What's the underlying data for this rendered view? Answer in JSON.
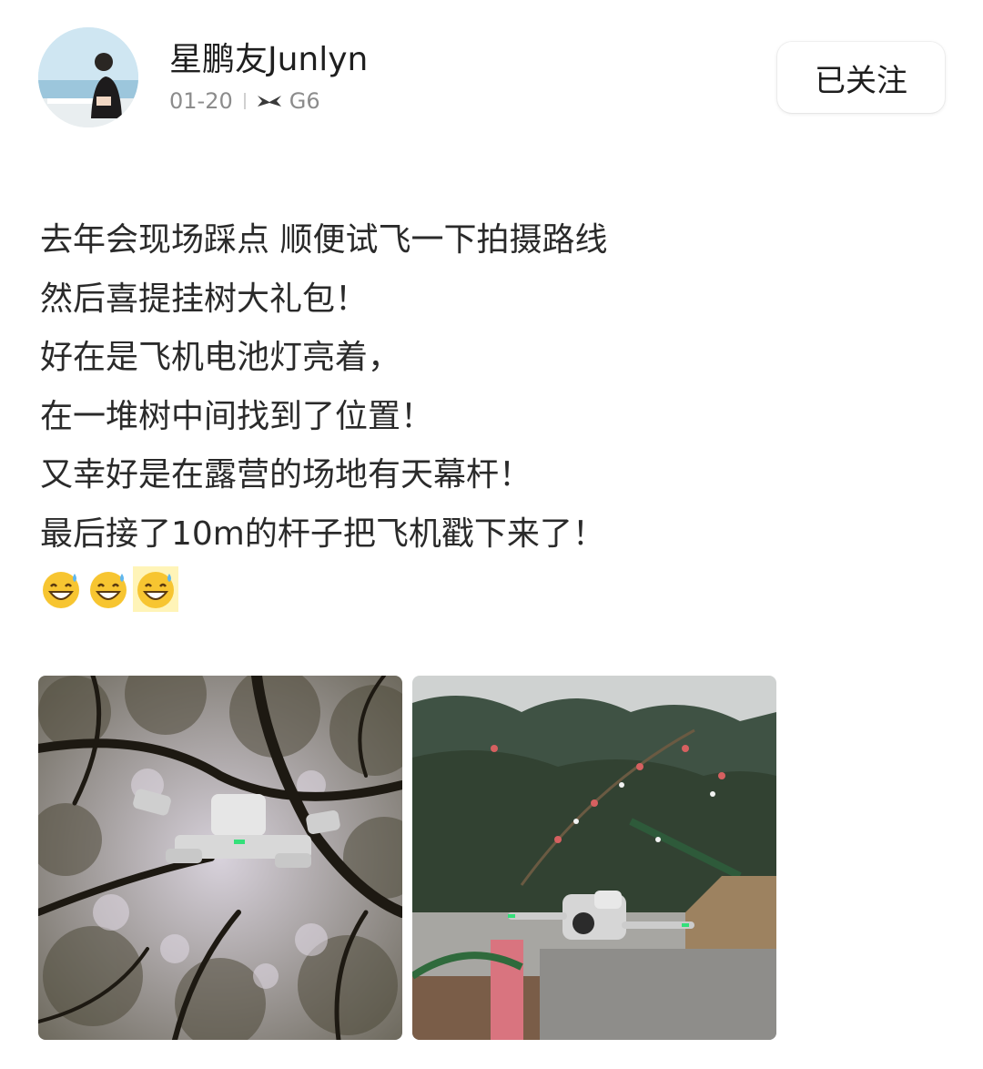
{
  "post": {
    "author": {
      "name": "星鹏友Junlyn",
      "date": "01-20",
      "car_model": "G6"
    },
    "follow_label": "已关注",
    "text_lines": [
      "去年会现场踩点 顺便试飞一下拍摄路线",
      "然后喜提挂树大礼包！",
      "好在是飞机电池灯亮着，",
      "在一堆树中间找到了位置！",
      "又幸好是在露营的场地有天幕杆！",
      "最后接了10m的杆子把飞机戳下来了！"
    ],
    "emojis": [
      "sweat-smile-emoji",
      "sweat-smile-emoji",
      "sweat-smile-emoji"
    ],
    "photos": [
      {
        "icon": "drone-in-tree-photo"
      },
      {
        "icon": "drone-campsite-photo"
      }
    ]
  },
  "icons": {
    "brand": "xpeng-logo-icon"
  },
  "colors": {
    "text": "#2a2a2a",
    "meta": "#8c8c8c",
    "emoji_highlight": "#fff4b8"
  }
}
